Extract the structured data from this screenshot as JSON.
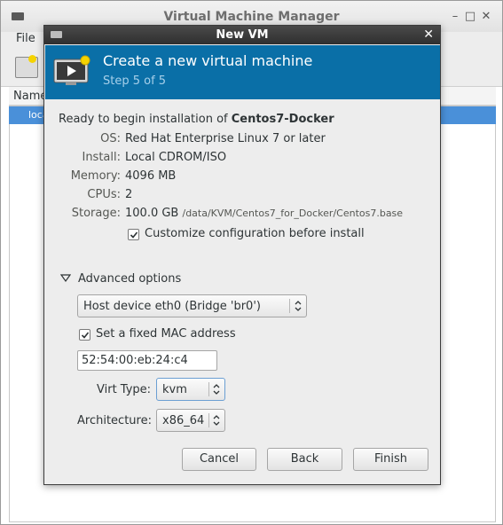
{
  "background_window": {
    "title": "Virtual Machine Manager",
    "menu_file": "File",
    "column_header": "Name",
    "selected_row": "loca"
  },
  "dialog": {
    "title": "New VM",
    "close_glyph": "✕",
    "banner_title": "Create a new virtual machine",
    "banner_step": "Step 5 of 5",
    "ready_prefix": "Ready to begin installation of ",
    "vm_name": "Centos7-Docker",
    "summary": {
      "os_label": "OS:",
      "os_value": "Red Hat Enterprise Linux 7 or later",
      "install_label": "Install:",
      "install_value": "Local CDROM/ISO",
      "memory_label": "Memory:",
      "memory_value": "4096 MB",
      "cpus_label": "CPUs:",
      "cpus_value": "2",
      "storage_label": "Storage:",
      "storage_value": "100.0 GB",
      "storage_path": "/data/KVM/Centos7_for_Docker/Centos7.base"
    },
    "customize_label": "Customize configuration before install",
    "customize_checked": true,
    "advanced_label": "Advanced options",
    "network_select": "Host device eth0 (Bridge 'br0')",
    "fixed_mac_label": "Set a fixed MAC address",
    "fixed_mac_checked": true,
    "mac_value": "52:54:00:eb:24:c4",
    "virt_type_label": "Virt Type:",
    "virt_type_value": "kvm",
    "arch_label": "Architecture:",
    "arch_value": "x86_64",
    "buttons": {
      "cancel": "Cancel",
      "back": "Back",
      "finish": "Finish"
    }
  },
  "colors": {
    "banner_bg": "#0a6fa7",
    "selection": "#4a90d9",
    "dialog_bg": "#ededed"
  },
  "icons": [
    "vm-screen-icon",
    "check-icon",
    "expander-down-icon",
    "updown-arrows-icon",
    "close-icon",
    "minimize-icon",
    "maximize-icon"
  ]
}
